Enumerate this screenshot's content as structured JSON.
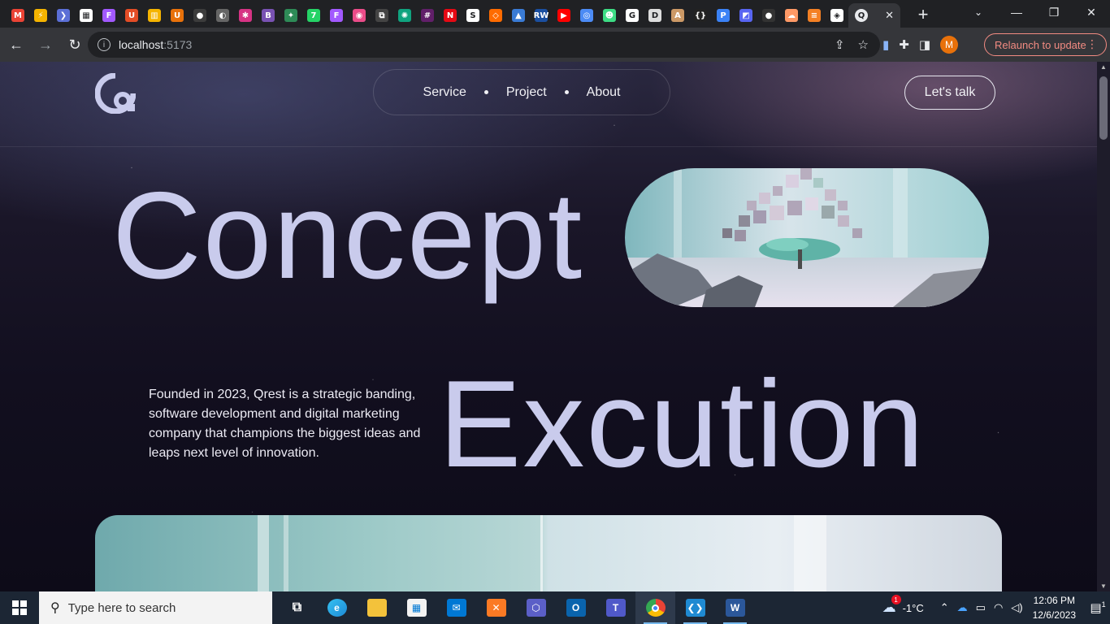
{
  "browser": {
    "tabs_favicons": [
      {
        "name": "gmail-icon",
        "color": "#ea4335",
        "glyph": "M"
      },
      {
        "name": "bolt-icon",
        "color": "#f5b400",
        "glyph": "⚡"
      },
      {
        "name": "chevron-app-icon",
        "color": "#5b6fd6",
        "glyph": "❯"
      },
      {
        "name": "photo-icon",
        "color": "#ffffff",
        "glyph": "▦"
      },
      {
        "name": "figma-icon",
        "color": "#a259ff",
        "glyph": "F"
      },
      {
        "name": "u-icon",
        "color": "#e44d26",
        "glyph": "U"
      },
      {
        "name": "chart-icon",
        "color": "#f5b400",
        "glyph": "▥"
      },
      {
        "name": "u-swirl-icon",
        "color": "#e8710a",
        "glyph": "U"
      },
      {
        "name": "github-icon",
        "color": "#3c3c3c",
        "glyph": "●"
      },
      {
        "name": "globe-icon",
        "color": "#666666",
        "glyph": "◐"
      },
      {
        "name": "react-icon",
        "color": "#d63384",
        "glyph": "✱"
      },
      {
        "name": "bootstrap-icon",
        "color": "#7952b3",
        "glyph": "B"
      },
      {
        "name": "blocks-icon",
        "color": "#2e8b57",
        "glyph": "✦"
      },
      {
        "name": "whatsapp-icon",
        "color": "#25d366",
        "glyph": "7"
      },
      {
        "name": "figma-icon-2",
        "color": "#a259ff",
        "glyph": "F"
      },
      {
        "name": "dribbble-icon",
        "color": "#ea4c89",
        "glyph": "◉"
      },
      {
        "name": "framer-icon",
        "color": "#444444",
        "glyph": "⧉"
      },
      {
        "name": "chatgpt-icon",
        "color": "#10a37f",
        "glyph": "✺"
      },
      {
        "name": "slack-icon",
        "color": "#611f69",
        "glyph": "#"
      },
      {
        "name": "netflix-icon",
        "color": "#e50914",
        "glyph": "N"
      },
      {
        "name": "s-icon",
        "color": "#ffffff",
        "glyph": "S"
      },
      {
        "name": "shape-icon",
        "color": "#ff6b00",
        "glyph": "◇"
      },
      {
        "name": "graduation-icon",
        "color": "#3a7bd5",
        "glyph": "▲"
      },
      {
        "name": "rw-icon",
        "color": "#1b4fa0",
        "glyph": "RW"
      },
      {
        "name": "youtube-icon",
        "color": "#ff0000",
        "glyph": "▶"
      },
      {
        "name": "g-circle-icon",
        "color": "#4c8bf5",
        "glyph": "◎"
      },
      {
        "name": "android-icon",
        "color": "#3ddc84",
        "glyph": "☻"
      },
      {
        "name": "google-icon",
        "color": "#ffffff",
        "glyph": "G"
      },
      {
        "name": "d-icon",
        "color": "#dddddd",
        "glyph": "D"
      },
      {
        "name": "ai-icon",
        "color": "#cc9966",
        "glyph": "A"
      },
      {
        "name": "brackets-icon",
        "color": "#222222",
        "glyph": "{}"
      },
      {
        "name": "pin-icon",
        "color": "#3b82f6",
        "glyph": "P"
      },
      {
        "name": "code-icon",
        "color": "#5865f2",
        "glyph": "◩"
      },
      {
        "name": "dark-circle-icon",
        "color": "#333333",
        "glyph": "●"
      },
      {
        "name": "cloud-icon",
        "color": "#ff9966",
        "glyph": "☁"
      },
      {
        "name": "stackoverflow-icon",
        "color": "#f48024",
        "glyph": "≡"
      },
      {
        "name": "codepen-icon",
        "color": "#ffffff",
        "glyph": "◈"
      }
    ],
    "address": {
      "host": "localhost",
      "port": ":5173"
    },
    "relaunch_label": "Relaunch to update",
    "profile_initial": "M"
  },
  "site": {
    "nav": {
      "items": [
        "Service",
        "Project",
        "About"
      ]
    },
    "cta_label": "Let's talk",
    "headline_1": "Concept",
    "headline_2": "Excution",
    "description": "Founded in 2023, Qrest is a strategic banding, software development and digital marketing company that champions the biggest ideas and leaps next level of innovation.",
    "colors": {
      "headline": "#c9cbec",
      "text": "#ecebf4"
    }
  },
  "taskbar": {
    "search_placeholder": "Type here to search",
    "weather": "-1°C",
    "weather_badge": "1",
    "time": "12:06 PM",
    "date": "12/6/2023",
    "notif_count": "1"
  }
}
